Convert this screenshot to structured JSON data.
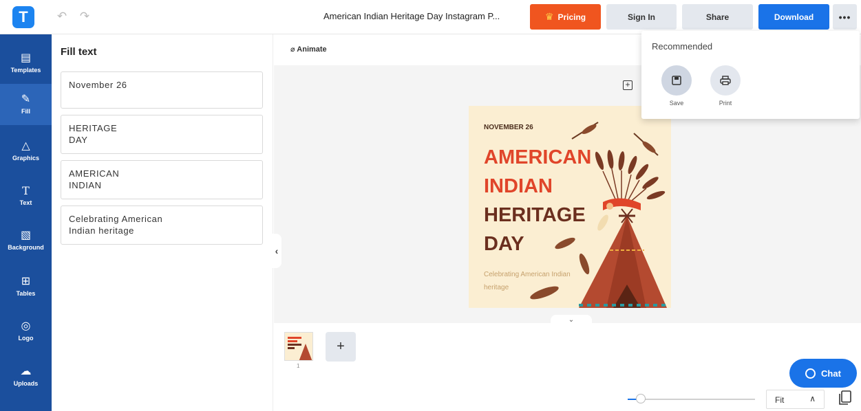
{
  "topbar": {
    "logo_letter": "T",
    "document_title": "American Indian Heritage Day Instagram P...",
    "pricing_label": "Pricing",
    "signin_label": "Sign In",
    "share_label": "Share",
    "download_label": "Download",
    "more_label": "•••"
  },
  "rail": {
    "items": [
      {
        "label": "Templates",
        "icon": "templates-icon"
      },
      {
        "label": "Fill",
        "icon": "pencil-icon"
      },
      {
        "label": "Graphics",
        "icon": "shapes-icon"
      },
      {
        "label": "Text",
        "icon": "text-icon"
      },
      {
        "label": "Background",
        "icon": "background-icon"
      },
      {
        "label": "Tables",
        "icon": "table-icon"
      },
      {
        "label": "Logo",
        "icon": "logo-icon"
      },
      {
        "label": "Uploads",
        "icon": "upload-cloud-icon"
      }
    ]
  },
  "panel": {
    "title": "Fill text",
    "fields": [
      "November 26",
      "HERITAGE\nDAY",
      "AMERICAN\nINDIAN",
      "Celebrating American\nIndian heritage"
    ]
  },
  "canvas": {
    "animate_label": "Animate",
    "poster": {
      "date": "NOVEMBER 26",
      "line1": "AMERICAN",
      "line2": "INDIAN",
      "line3": "HERITAGE",
      "line4": "DAY",
      "subtitle": "Celebrating American Indian heritage"
    },
    "page_number": "1"
  },
  "dropdown": {
    "title": "Recommended",
    "save_label": "Save",
    "print_label": "Print"
  },
  "chat": {
    "label": "Chat"
  },
  "zoom": {
    "value": "Fit",
    "level": 0.1
  },
  "colors": {
    "brand_blue": "#1a73e8",
    "rail_blue": "#1b4f9d",
    "pricing_orange": "#f0551f",
    "poster_red": "#e0452a",
    "poster_brown": "#6b2f1f"
  }
}
